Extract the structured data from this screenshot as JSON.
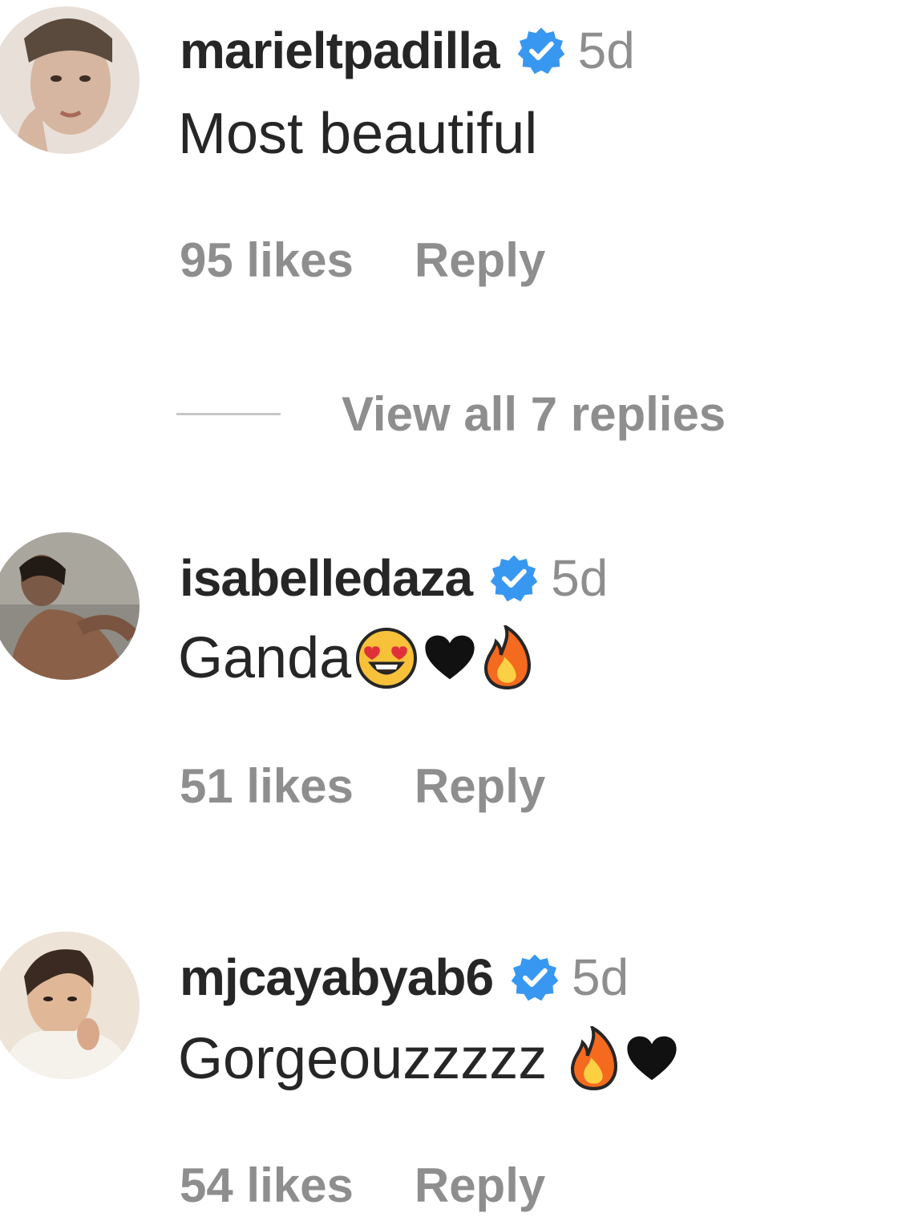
{
  "comments": [
    {
      "username": "marieltpadilla",
      "time": "5d",
      "text": "Most beautiful",
      "emojis": [],
      "likes": "95 likes",
      "reply": "Reply"
    },
    {
      "username": "isabelledaza",
      "time": "5d",
      "text": "Ganda",
      "emojis": [
        "heart-eyes-emoji",
        "black-heart-emoji",
        "fire-emoji"
      ],
      "likes": "51 likes",
      "reply": "Reply"
    },
    {
      "username": "mjcayabyab6",
      "time": "5d",
      "text": "Gorgeouzzzzz",
      "emojis": [
        "fire-emoji",
        "black-heart-emoji"
      ],
      "likes": "54 likes",
      "reply": "Reply"
    }
  ],
  "view_replies": {
    "label": "View all 7 replies"
  },
  "colors": {
    "text_primary": "#262626",
    "text_secondary": "#8e8e8e",
    "verified_blue": "#3897f0",
    "divider": "#c7c7c7"
  }
}
